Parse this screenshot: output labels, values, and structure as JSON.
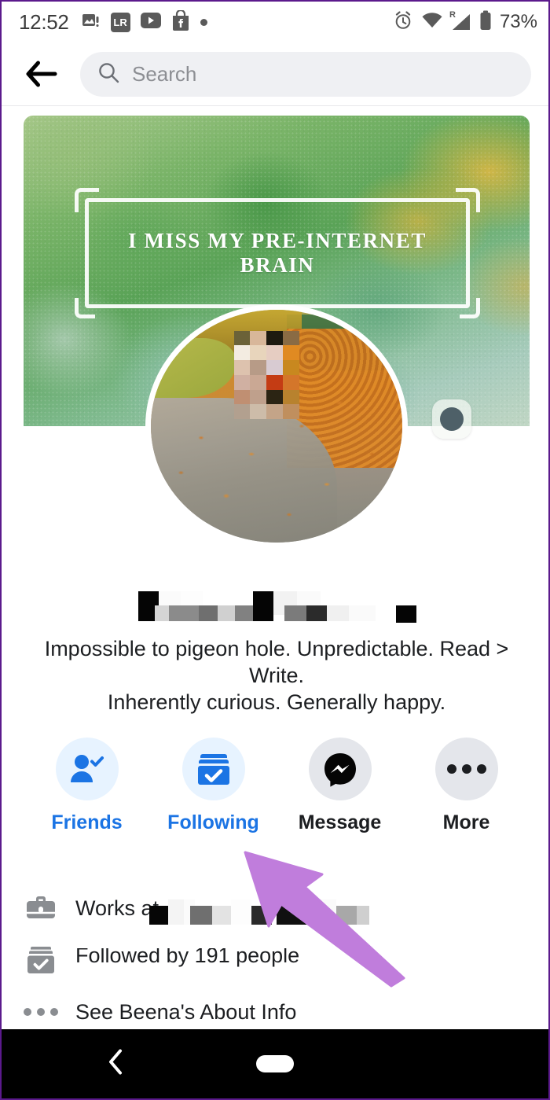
{
  "status_bar": {
    "time": "12:52",
    "battery_percent": "73%",
    "roaming_label": "R",
    "icons": [
      "photo-alert-icon",
      "lightroom-icon",
      "youtube-icon",
      "facebook-marketplace-icon",
      "dot-icon",
      "alarm-icon",
      "wifi-icon",
      "cell-signal-icon",
      "battery-icon"
    ],
    "lightroom_label": "LR"
  },
  "header": {
    "back_icon": "back-arrow-icon",
    "search_placeholder": "Search",
    "search_value": "",
    "search_icon": "search-icon"
  },
  "cover": {
    "quote": "I MISS MY PRE-INTERNET BRAIN",
    "camera_icon": "camera-icon",
    "alt": "watercolor green and gold cover photo"
  },
  "profile": {
    "avatar_alt": "autumn path with fallen leaves, person pixelated",
    "name_redacted": true,
    "bio_line_1": "Impossible to pigeon hole. Unpredictable. Read >",
    "bio_line_2": "Write.",
    "bio_line_3": "Inherently curious. Generally happy."
  },
  "actions": [
    {
      "label": "Friends",
      "icon": "friend-check-icon",
      "icon_style": "blue",
      "label_style": "blue"
    },
    {
      "label": "Following",
      "icon": "following-check-icon",
      "icon_style": "blue",
      "label_style": "blue"
    },
    {
      "label": "Message",
      "icon": "messenger-icon",
      "icon_style": "grey",
      "label_style": "dark"
    },
    {
      "label": "More",
      "icon": "more-dots-icon",
      "icon_style": "grey",
      "label_style": "dark"
    }
  ],
  "info_rows": [
    {
      "icon": "briefcase-icon",
      "text": "Works at",
      "redacted": true
    },
    {
      "icon": "following-check-icon",
      "text": "Followed by 191 people",
      "redacted": false
    },
    {
      "icon": "more-dots-icon",
      "text": "See Beena's About Info",
      "redacted": false
    }
  ],
  "annotation": {
    "type": "arrow",
    "color": "#c07ddc",
    "points_to": "Following"
  },
  "nav_bar": {
    "back_icon": "nav-back-icon",
    "home_icon": "nav-home-pill-icon"
  },
  "colors": {
    "accent_blue": "#1b74e4",
    "icon_blue_bg": "#e7f3ff",
    "grey_bg": "#e4e6eb",
    "text_primary": "#1c1e21",
    "arrow_purple": "#c07ddc"
  }
}
